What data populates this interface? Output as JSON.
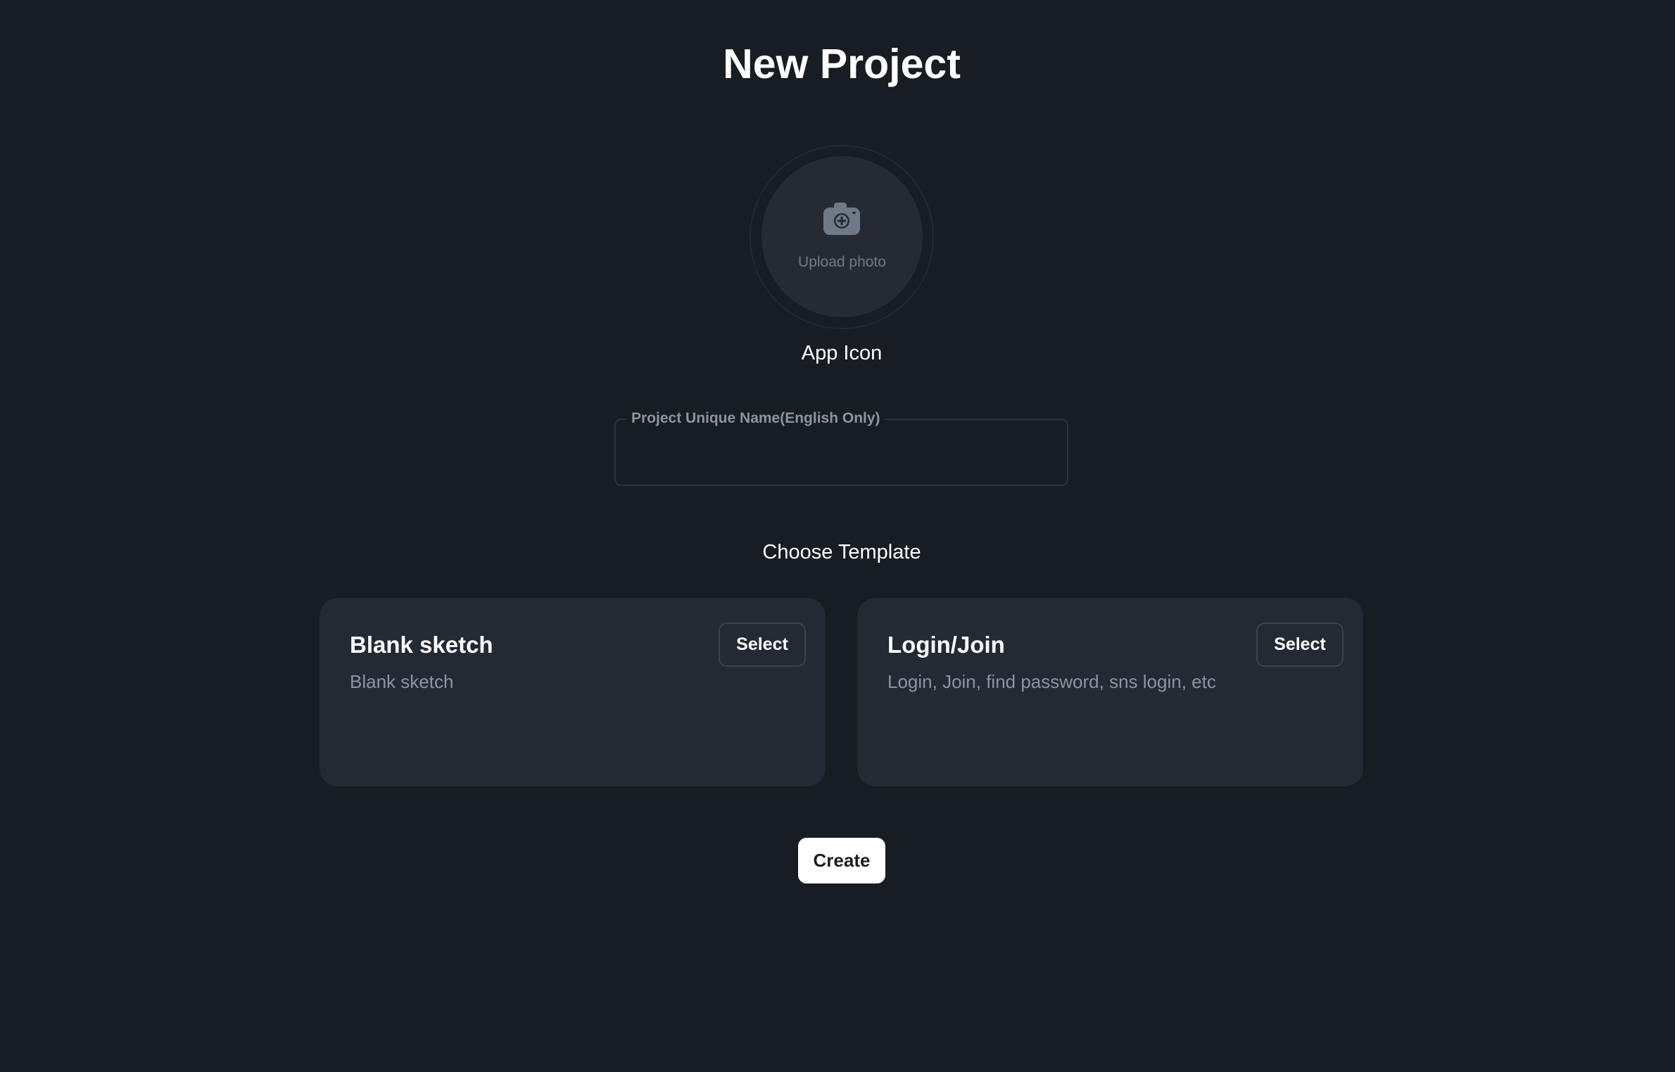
{
  "page": {
    "title": "New Project"
  },
  "app_icon": {
    "upload_label": "Upload photo",
    "icon": "camera-plus-icon",
    "caption": "App Icon"
  },
  "project_name_field": {
    "label": "Project Unique Name(English Only)",
    "value": "",
    "placeholder": ""
  },
  "templates": {
    "heading": "Choose Template",
    "items": [
      {
        "title": "Blank sketch",
        "description": "Blank sketch",
        "select_label": "Select"
      },
      {
        "title": "Login/Join",
        "description": "Login, Join, find password, sns login, etc",
        "select_label": "Select"
      }
    ]
  },
  "actions": {
    "create_label": "Create"
  },
  "colors": {
    "background": "#181c23",
    "card": "#232a34",
    "muted_text": "#8b95a2",
    "primary_button": "#ffffff"
  }
}
